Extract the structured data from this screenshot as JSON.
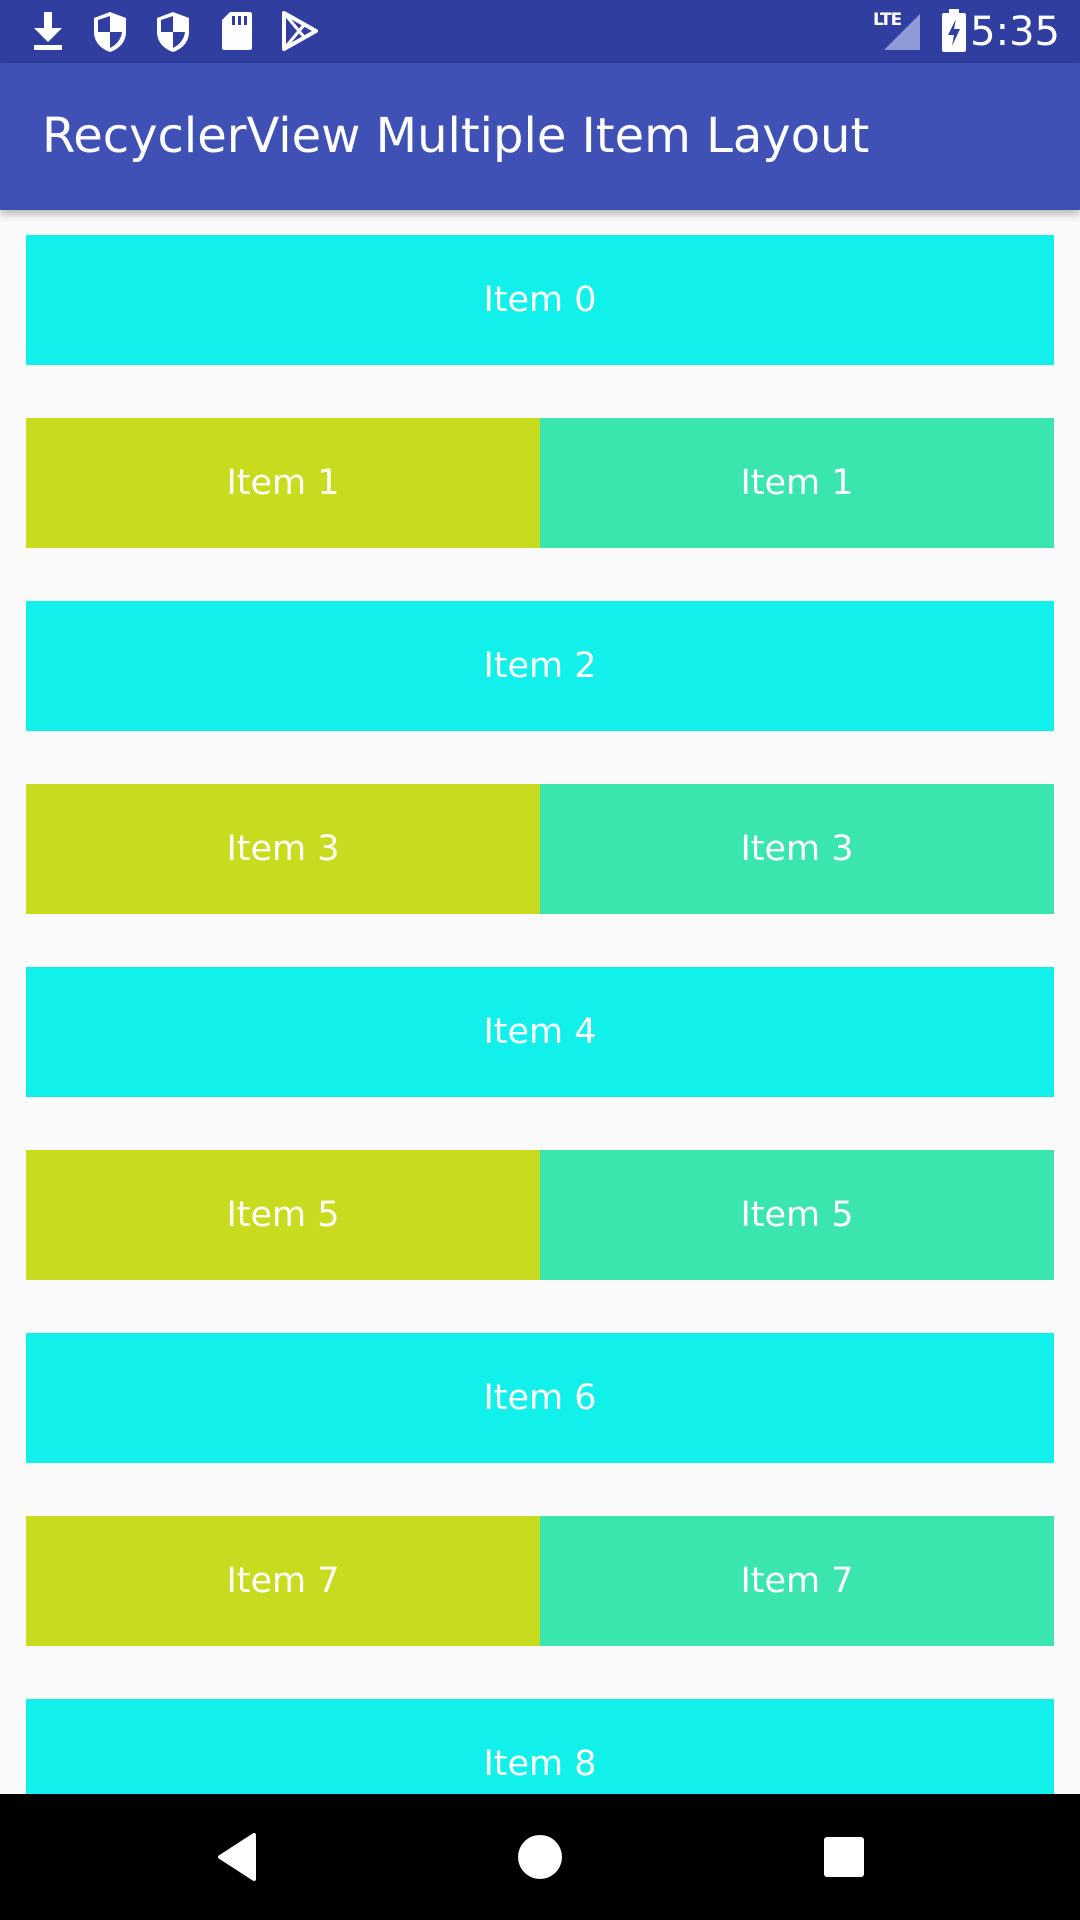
{
  "status_bar": {
    "time": "5:35",
    "network_label": "LTE",
    "left_icons": [
      "download-icon",
      "shield-icon",
      "shield-icon",
      "sd-card-icon",
      "play-store-icon"
    ],
    "right_icons": [
      "signal-icon",
      "battery-charging-icon"
    ]
  },
  "app_bar": {
    "title": "RecyclerView Multiple Item Layout"
  },
  "colors": {
    "status_bar": "#303f9f",
    "app_bar": "#3f51b5",
    "background": "#fafafa",
    "cyan_item": "#12f0ec",
    "lime_item": "#c8db1f",
    "mint_item": "#3ae5ae",
    "nav_bar": "#000000"
  },
  "list": {
    "rows": [
      {
        "type": "single",
        "cells": [
          "Item 0"
        ]
      },
      {
        "type": "double",
        "cells": [
          "Item 1",
          "Item 1"
        ]
      },
      {
        "type": "single",
        "cells": [
          "Item 2"
        ]
      },
      {
        "type": "double",
        "cells": [
          "Item 3",
          "Item 3"
        ]
      },
      {
        "type": "single",
        "cells": [
          "Item 4"
        ]
      },
      {
        "type": "double",
        "cells": [
          "Item 5",
          "Item 5"
        ]
      },
      {
        "type": "single",
        "cells": [
          "Item 6"
        ]
      },
      {
        "type": "double",
        "cells": [
          "Item 7",
          "Item 7"
        ]
      },
      {
        "type": "single",
        "cells": [
          "Item 8"
        ]
      }
    ]
  },
  "nav_bar": {
    "icons": [
      "back-icon",
      "home-icon",
      "recents-icon"
    ]
  }
}
